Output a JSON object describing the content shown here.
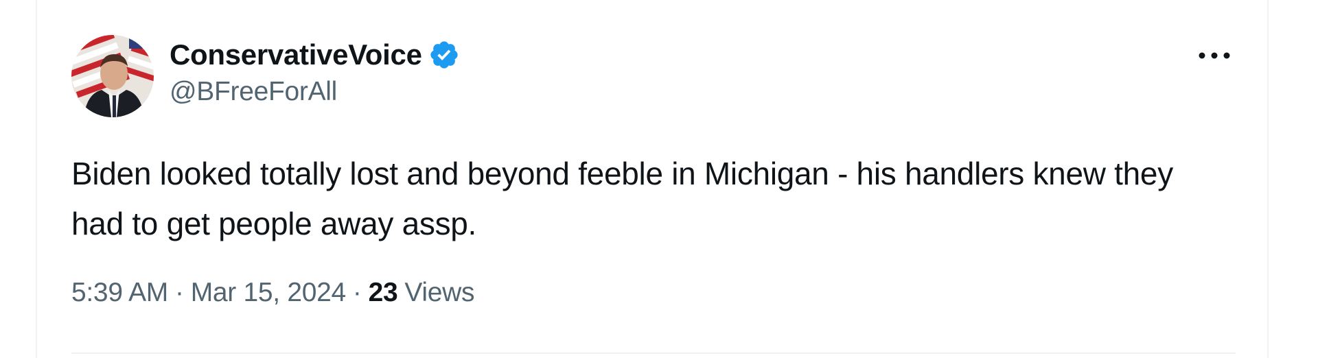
{
  "tweet": {
    "author": {
      "display_name": "ConservativeVoice",
      "handle": "@BFreeForAll",
      "verified": true,
      "avatar_icon": "profile-photo"
    },
    "text": "Biden looked totally lost and beyond feeble in Michigan - his handlers knew they had to get people away assp.",
    "time": "5:39 AM",
    "date": "Mar 15, 2024",
    "separator": "·",
    "views_count": "23",
    "views_label": "Views",
    "more_icon": "more-horizontal-icon"
  },
  "colors": {
    "text_primary": "#0f1419",
    "text_secondary": "#536471",
    "verified_blue": "#1d9bf0",
    "border": "#eff3f4"
  }
}
